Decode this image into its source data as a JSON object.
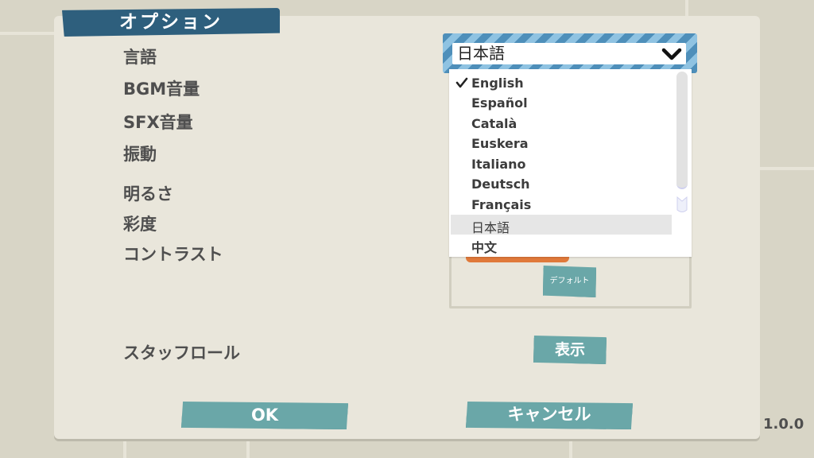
{
  "title": "オプション",
  "labels": {
    "language": "言語",
    "bgm_volume": "BGM音量",
    "sfx_volume": "SFX音量",
    "vibration": "振動",
    "brightness": "明るさ",
    "saturation": "彩度",
    "contrast": "コントラスト",
    "credits": "スタッフロール"
  },
  "language_select": {
    "selected": "日本語",
    "options": [
      "English",
      "Español",
      "Català",
      "Euskera",
      "Italiano",
      "Deutsch",
      "Français",
      "日本語",
      "中文"
    ],
    "checked_option": "English",
    "highlighted_option": "日本語"
  },
  "buttons": {
    "default": "デフォルト",
    "show": "表示",
    "ok": "OK",
    "cancel": "キャンセル"
  },
  "version": "1.0.0",
  "colors": {
    "title_bg": "#2e5f7d",
    "button_bg": "#6aa7a8",
    "accent_orange": "#e0793a",
    "select_stripe_dark": "#4e8fba",
    "select_stripe_light": "#8fc3e2"
  },
  "icons": {
    "dropdown": "chevron-down-icon",
    "checked": "checkmark-icon",
    "scroll": "scrollbar"
  }
}
